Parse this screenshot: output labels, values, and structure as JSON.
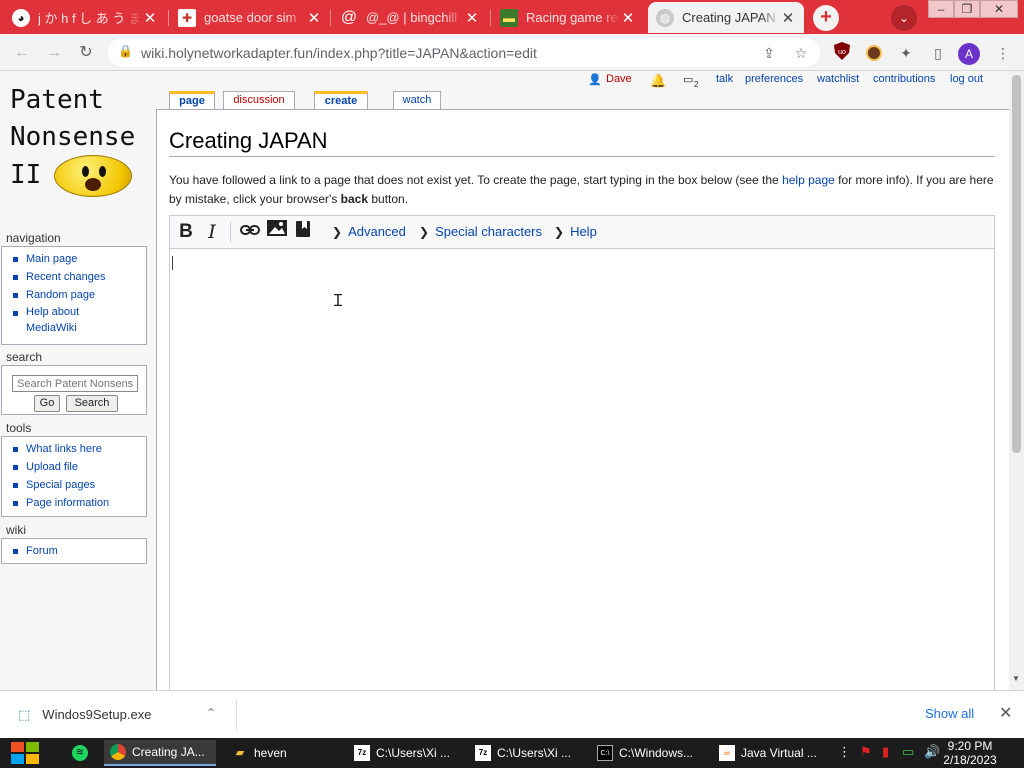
{
  "browser": {
    "tabs": [
      {
        "title": "j か h f し あ う ま"
      },
      {
        "title": "goatse door sim"
      },
      {
        "title": "@_@ | bingchill"
      },
      {
        "title": "Racing game re"
      },
      {
        "title": "Creating JAPAN"
      }
    ],
    "new_tab_label": "+",
    "url": "wiki.holynetworkadapter.fun/index.php?title=JAPAN&action=edit",
    "profile_initial": "A"
  },
  "wiki": {
    "logo": {
      "line1": "Patent",
      "line2": "Nonsense",
      "line3": "II"
    },
    "page_tabs": {
      "page": "page",
      "discussion": "discussion",
      "create": "create",
      "watch": "watch"
    },
    "personal_tools": {
      "user": "Dave",
      "notification_count": "2",
      "talk": "talk",
      "preferences": "preferences",
      "watchlist": "watchlist",
      "contributions": "contributions",
      "logout": "log out"
    },
    "heading": "Creating JAPAN",
    "intro": {
      "part1": "You have followed a link to a page that does not exist yet. To create the page, start typing in the box below (see the ",
      "help_link": "help page",
      "part2": " for more info). If you are here by mistake, click your browser's ",
      "back_word": "back",
      "part3": " button."
    },
    "editor": {
      "advanced": "Advanced",
      "special_chars": "Special characters",
      "help": "Help",
      "bold": "B",
      "italic": "I"
    },
    "sidebar": {
      "navigation": {
        "title": "navigation",
        "items": [
          "Main page",
          "Recent changes",
          "Random page"
        ],
        "help_line1": "Help about",
        "help_line2": "MediaWiki"
      },
      "search": {
        "title": "search",
        "placeholder": "Search Patent Nonsense II",
        "go": "Go",
        "search": "Search"
      },
      "tools": {
        "title": "tools",
        "items": [
          "What links here",
          "Upload file",
          "Special pages",
          "Page information"
        ]
      },
      "wiki": {
        "title": "wiki",
        "items": [
          "Forum"
        ]
      }
    }
  },
  "downloads": {
    "file": "Windos9Setup.exe",
    "show_all": "Show all"
  },
  "taskbar": {
    "items": [
      "Creating JA...",
      "heven",
      "C:\\Users\\Xi ...",
      "C:\\Users\\Xi ...",
      "C:\\Windows...",
      "Java Virtual ..."
    ],
    "time": "9:20 PM",
    "date": "2/18/2023"
  }
}
